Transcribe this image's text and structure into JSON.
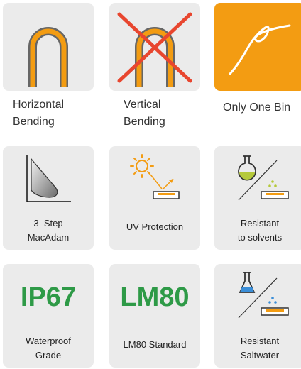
{
  "colors": {
    "orange": "#f39c12",
    "green": "#2e9a47",
    "red": "#e8462f",
    "tile": "#ebebeb"
  },
  "top_row": [
    {
      "icon": "horizontal-bending-icon",
      "caption_lines": [
        "Horizontal",
        "Bending"
      ]
    },
    {
      "icon": "vertical-bending-crossed-icon",
      "caption_lines": [
        "Vertical",
        "Bending"
      ]
    },
    {
      "icon": "only-one-bin-icon",
      "caption_lines": [
        "Only One Bin"
      ]
    }
  ],
  "cards": [
    {
      "icon": "macadam-chromaticity-icon",
      "label_lines": [
        "3–Step",
        "MacAdam"
      ]
    },
    {
      "icon": "uv-protection-icon",
      "label_lines": [
        "UV Protection"
      ]
    },
    {
      "icon": "resistant-solvents-icon",
      "label_lines": [
        "Resistant",
        "to solvents"
      ]
    },
    {
      "text": "IP67",
      "label_lines": [
        "Waterproof",
        "Grade"
      ]
    },
    {
      "text": "LM80",
      "label_lines": [
        "LM80 Standard"
      ]
    },
    {
      "icon": "resistant-saltwater-icon",
      "label_lines": [
        "Resistant",
        "Saltwater"
      ]
    }
  ]
}
